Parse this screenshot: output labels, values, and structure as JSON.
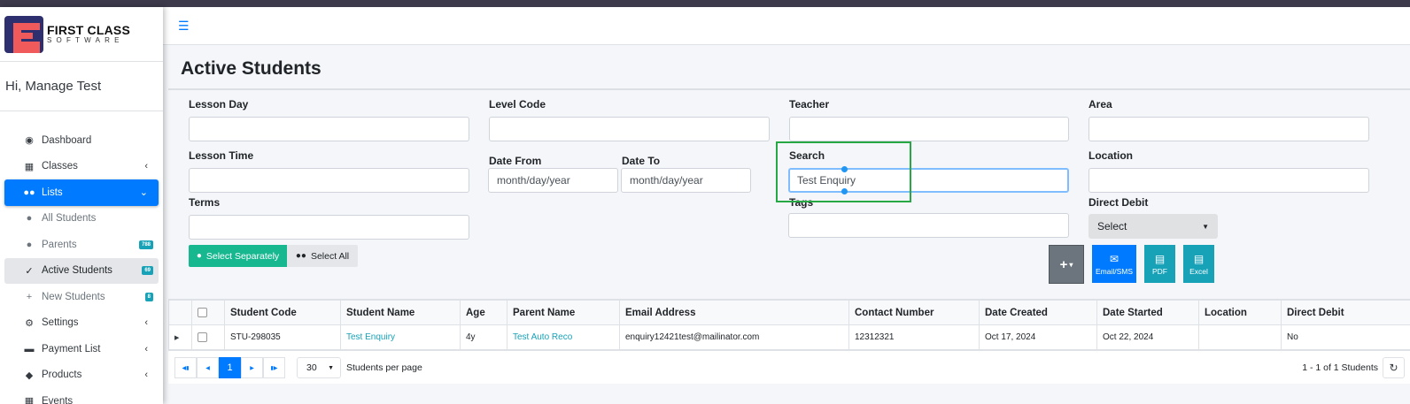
{
  "brand": {
    "name": "FIRST CLASS",
    "sub": "SOFTWARE"
  },
  "user": {
    "greeting": "Hi, Manage Test"
  },
  "sidebar": {
    "items": [
      {
        "label": "Dashboard"
      },
      {
        "label": "Classes"
      },
      {
        "label": "Lists"
      },
      {
        "label": "All Students"
      },
      {
        "label": "Parents",
        "badge": "788"
      },
      {
        "label": "Active Students",
        "badge": "69"
      },
      {
        "label": "New Students",
        "badge": "8"
      },
      {
        "label": "Settings"
      },
      {
        "label": "Payment List"
      },
      {
        "label": "Products"
      },
      {
        "label": "Events"
      }
    ]
  },
  "page": {
    "title": "Active Students"
  },
  "filters": {
    "lesson_day": {
      "label": "Lesson Day",
      "value": ""
    },
    "level_code": {
      "label": "Level Code",
      "value": ""
    },
    "teacher": {
      "label": "Teacher",
      "value": ""
    },
    "area": {
      "label": "Area",
      "value": ""
    },
    "lesson_time": {
      "label": "Lesson Time",
      "value": ""
    },
    "date_from": {
      "label": "Date From",
      "placeholder": "month/day/year"
    },
    "date_to": {
      "label": "Date To",
      "placeholder": "month/day/year"
    },
    "search": {
      "label": "Search",
      "value": "Test Enquiry"
    },
    "location": {
      "label": "Location",
      "value": ""
    },
    "terms": {
      "label": "Terms",
      "value": ""
    },
    "tags": {
      "label": "Tags",
      "value": ""
    },
    "direct_debit": {
      "label": "Direct Debit",
      "selected": "Select"
    }
  },
  "actions": {
    "select_separately": "Select Separately",
    "select_all": "Select All",
    "plus": "+",
    "email_sms": "Email/SMS",
    "pdf": "PDF",
    "excel": "Excel"
  },
  "table": {
    "columns": [
      "Student Code",
      "Student Name",
      "Age",
      "Parent Name",
      "Email Address",
      "Contact Number",
      "Date Created",
      "Date Started",
      "Location",
      "Direct Debit"
    ],
    "rows": [
      {
        "student_code": "STU-298035",
        "student_name": "Test Enquiry",
        "age": "4y",
        "parent_name": "Test Auto Reco",
        "email": "enquiry12421test@mailinator.com",
        "contact": "12312321",
        "date_created": "Oct 17, 2024",
        "date_started": "Oct 22, 2024",
        "location": "",
        "direct_debit": "No"
      }
    ]
  },
  "pager": {
    "current_page": "1",
    "page_size": "30",
    "per_page_label": "Students per page",
    "info": "1 - 1 of 1 Students"
  },
  "colors": {
    "primary": "#007bff",
    "teal": "#17a2b8",
    "green_highlight": "#28a745",
    "select_separately": "#17b890"
  }
}
